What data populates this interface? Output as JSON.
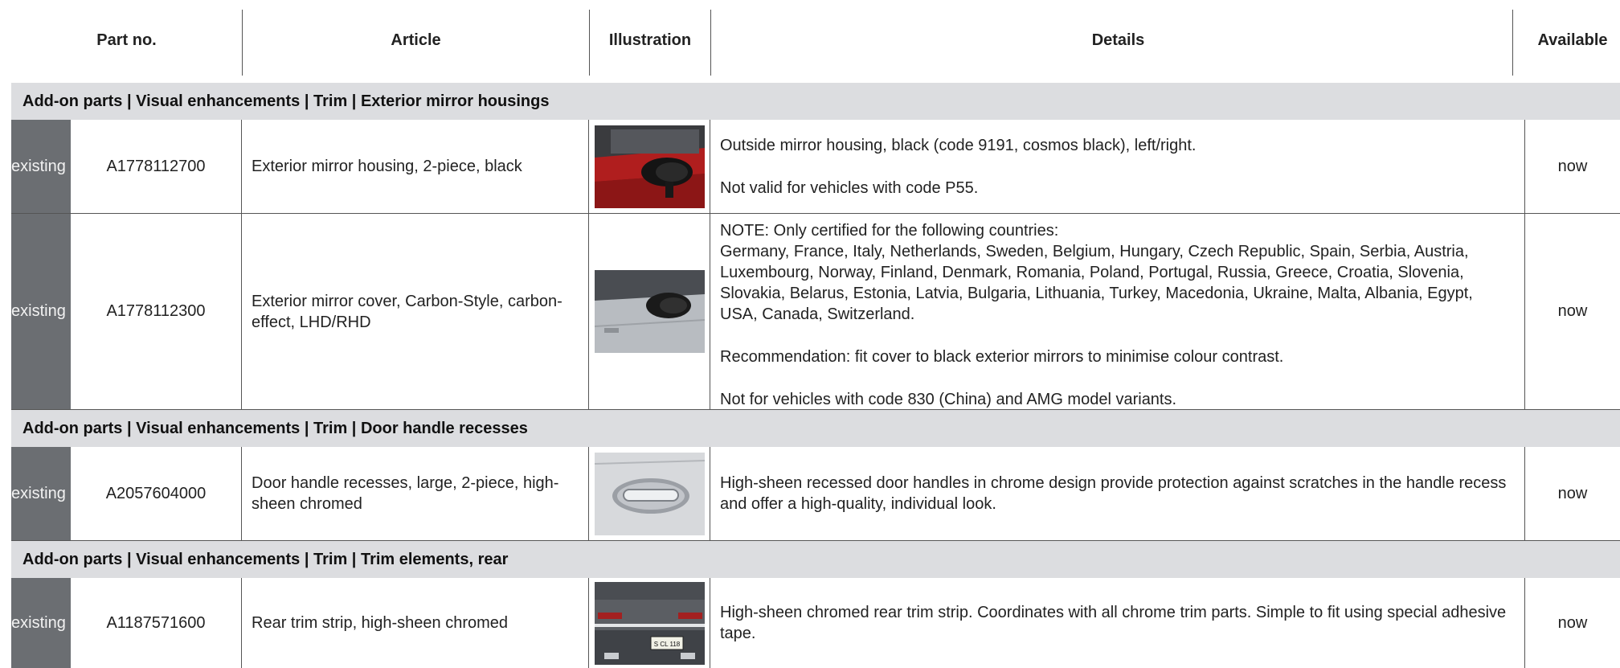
{
  "header": {
    "part_no": "Part no.",
    "article": "Article",
    "illustration": "Illustration",
    "details": "Details",
    "available": "Available"
  },
  "sections": [
    {
      "title": "Add-on parts | Visual enhancements | Trim | Exterior mirror housings"
    },
    {
      "title": "Add-on parts | Visual enhancements | Trim | Door handle recesses"
    },
    {
      "title": "Add-on parts | Visual enhancements | Trim | Trim elements, rear"
    }
  ],
  "rows": [
    {
      "status": "existing",
      "part_no": "A1778112700",
      "article": "Exterior mirror housing, 2-piece, black",
      "illustration": "red car exterior mirror with black housing",
      "details": [
        "Outside mirror housing, black (code 9191, cosmos black), left/right.",
        "Not valid for vehicles with code P55."
      ],
      "available": "now"
    },
    {
      "status": "existing",
      "part_no": "A1778112300",
      "article": "Exterior mirror cover, Carbon-Style, carbon-effect, LHD/RHD",
      "illustration": "silver car exterior mirror with carbon cover",
      "details": [
        "NOTE: Only certified for the following countries:\nGermany, France, Italy, Netherlands, Sweden, Belgium, Hungary, Czech Republic, Spain, Serbia, Austria, Luxembourg, Norway, Finland, Denmark, Romania, Poland, Portugal, Russia, Greece, Croatia, Slovenia, Slovakia, Belarus, Estonia, Latvia, Bulgaria, Lithuania, Turkey, Macedonia, Ukraine, Malta, Albania, Egypt, USA, Canada, Switzerland.",
        "Recommendation: fit cover to black exterior mirrors to minimise colour contrast.",
        "Not for vehicles with code 830 (China) and AMG model variants."
      ],
      "available": "now"
    },
    {
      "status": "existing",
      "part_no": "A2057604000",
      "article": "Door handle recesses, large, 2-piece, high-sheen chromed",
      "illustration": "chromed door handle recess",
      "details": [
        "High-sheen recessed door handles in chrome design provide protection against scratches in the handle recess and offer a high-quality, individual look."
      ],
      "available": "now"
    },
    {
      "status": "existing",
      "part_no": "A1187571600",
      "article": "Rear trim strip, high-sheen chromed",
      "illustration": "rear of dark grey car with chrome trim strip",
      "plate_text": "S CL 118",
      "details": [
        "High-sheen chromed rear trim strip. Coordinates with all chrome trim parts. Simple to fit using special adhesive tape."
      ],
      "available": "now"
    }
  ]
}
